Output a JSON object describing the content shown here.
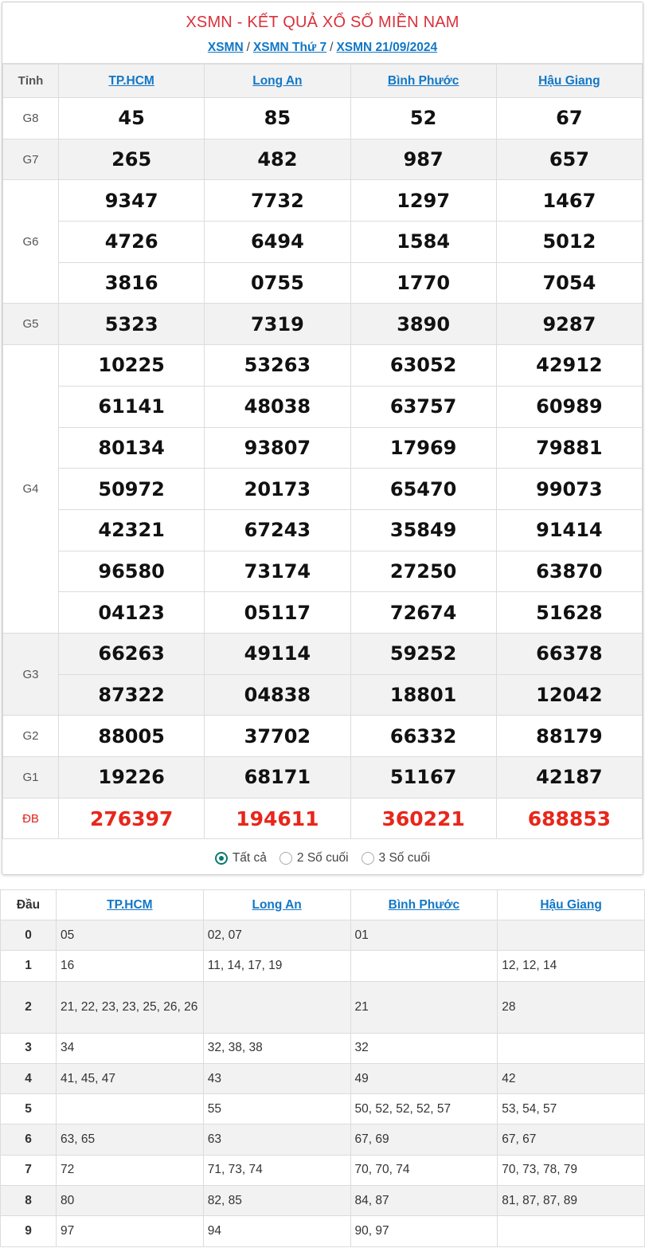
{
  "header": {
    "title": "XSMN - KẾT QUẢ XỔ SỐ MIỀN NAM",
    "breadcrumbs": [
      "XSMN",
      "XSMN Thứ 7",
      "XSMN 21/09/2024"
    ],
    "separator": "/"
  },
  "results": {
    "label_header": "Tỉnh",
    "provinces": [
      "TP.HCM",
      "Long An",
      "Bình Phước",
      "Hậu Giang"
    ],
    "prizes": [
      {
        "label": "G8",
        "rows": [
          [
            "45",
            "85",
            "52",
            "67"
          ]
        ]
      },
      {
        "label": "G7",
        "rows": [
          [
            "265",
            "482",
            "987",
            "657"
          ]
        ]
      },
      {
        "label": "G6",
        "rows": [
          [
            "9347",
            "7732",
            "1297",
            "1467"
          ],
          [
            "4726",
            "6494",
            "1584",
            "5012"
          ],
          [
            "3816",
            "0755",
            "1770",
            "7054"
          ]
        ]
      },
      {
        "label": "G5",
        "rows": [
          [
            "5323",
            "7319",
            "3890",
            "9287"
          ]
        ]
      },
      {
        "label": "G4",
        "rows": [
          [
            "10225",
            "53263",
            "63052",
            "42912"
          ],
          [
            "61141",
            "48038",
            "63757",
            "60989"
          ],
          [
            "80134",
            "93807",
            "17969",
            "79881"
          ],
          [
            "50972",
            "20173",
            "65470",
            "99073"
          ],
          [
            "42321",
            "67243",
            "35849",
            "91414"
          ],
          [
            "96580",
            "73174",
            "27250",
            "63870"
          ],
          [
            "04123",
            "05117",
            "72674",
            "51628"
          ]
        ]
      },
      {
        "label": "G3",
        "rows": [
          [
            "66263",
            "49114",
            "59252",
            "66378"
          ],
          [
            "87322",
            "04838",
            "18801",
            "12042"
          ]
        ]
      },
      {
        "label": "G2",
        "rows": [
          [
            "88005",
            "37702",
            "66332",
            "88179"
          ]
        ]
      },
      {
        "label": "G1",
        "rows": [
          [
            "19226",
            "68171",
            "51167",
            "42187"
          ]
        ]
      },
      {
        "label": "ĐB",
        "rows": [
          [
            "276397",
            "194611",
            "360221",
            "688853"
          ]
        ]
      }
    ]
  },
  "filters": {
    "options": [
      "Tất cả",
      "2 Số cuối",
      "3 Số cuối"
    ],
    "selected": "Tất cả"
  },
  "loto": {
    "header_label": "Đầu",
    "provinces": [
      "TP.HCM",
      "Long An",
      "Bình Phước",
      "Hậu Giang"
    ],
    "rows": [
      {
        "dau": "0",
        "values": [
          "05",
          "02, 07",
          "01",
          ""
        ]
      },
      {
        "dau": "1",
        "values": [
          "16",
          "11, 14, 17, 19",
          "",
          "12, 12, 14"
        ]
      },
      {
        "dau": "2",
        "values": [
          "21, 22, 23, 23, 25, 26, 26",
          "",
          "21",
          "28"
        ]
      },
      {
        "dau": "3",
        "values": [
          "34",
          "32, 38, 38",
          "32",
          ""
        ]
      },
      {
        "dau": "4",
        "values": [
          "41, 45, 47",
          "43",
          "49",
          "42"
        ]
      },
      {
        "dau": "5",
        "values": [
          "",
          "55",
          "50, 52, 52, 52, 57",
          "53, 54, 57"
        ]
      },
      {
        "dau": "6",
        "values": [
          "63, 65",
          "63",
          "67, 69",
          "67, 67"
        ]
      },
      {
        "dau": "7",
        "values": [
          "72",
          "71, 73, 74",
          "70, 70, 74",
          "70, 73, 78, 79"
        ]
      },
      {
        "dau": "8",
        "values": [
          "80",
          "82, 85",
          "84, 87",
          "81, 87, 87, 89"
        ]
      },
      {
        "dau": "9",
        "values": [
          "97",
          "94",
          "90, 97",
          ""
        ]
      }
    ]
  },
  "colors": {
    "title": "#d9313b",
    "link": "#1277c6",
    "special_prize": "#e8261b",
    "radio_selected": "#0b7a6e",
    "shaded_row": "#f2f2f2"
  }
}
